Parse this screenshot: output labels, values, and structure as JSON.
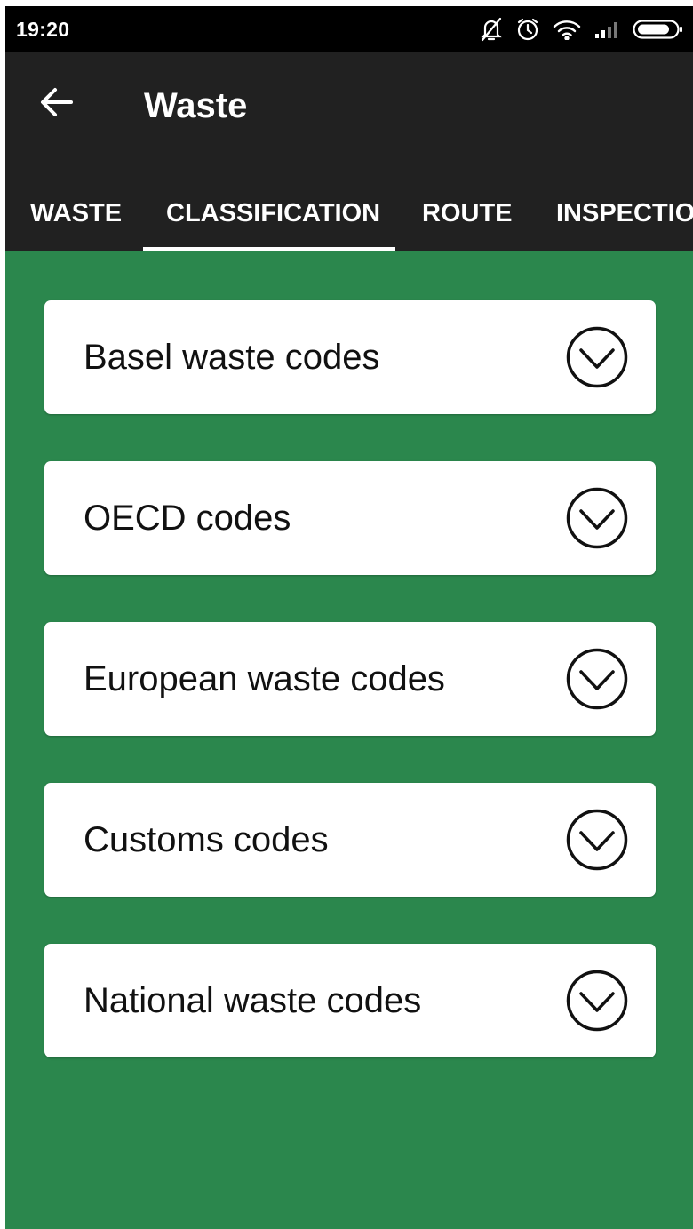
{
  "status_bar": {
    "time": "19:20",
    "icons": [
      "bell-off-icon",
      "alarm-icon",
      "wifi-icon",
      "signal-icon",
      "battery-icon"
    ]
  },
  "app_bar": {
    "back_icon": "arrow-left-icon",
    "title": "Waste"
  },
  "tabs": [
    {
      "label": "WASTE",
      "selected": false
    },
    {
      "label": "CLASSIFICATION",
      "selected": true
    },
    {
      "label": "ROUTE",
      "selected": false
    },
    {
      "label": "INSPECTIO",
      "selected": false
    }
  ],
  "sections": [
    {
      "label": "Basel waste codes",
      "icon": "chevron-down-circle-icon"
    },
    {
      "label": "OECD codes",
      "icon": "chevron-down-circle-icon"
    },
    {
      "label": "European waste codes",
      "icon": "chevron-down-circle-icon"
    },
    {
      "label": "Customs codes",
      "icon": "chevron-down-circle-icon"
    },
    {
      "label": "National waste codes",
      "icon": "chevron-down-circle-icon"
    }
  ],
  "colors": {
    "content_background": "#2b874d",
    "app_bar": "#212121",
    "status_bar": "#000000",
    "card": "#ffffff"
  }
}
